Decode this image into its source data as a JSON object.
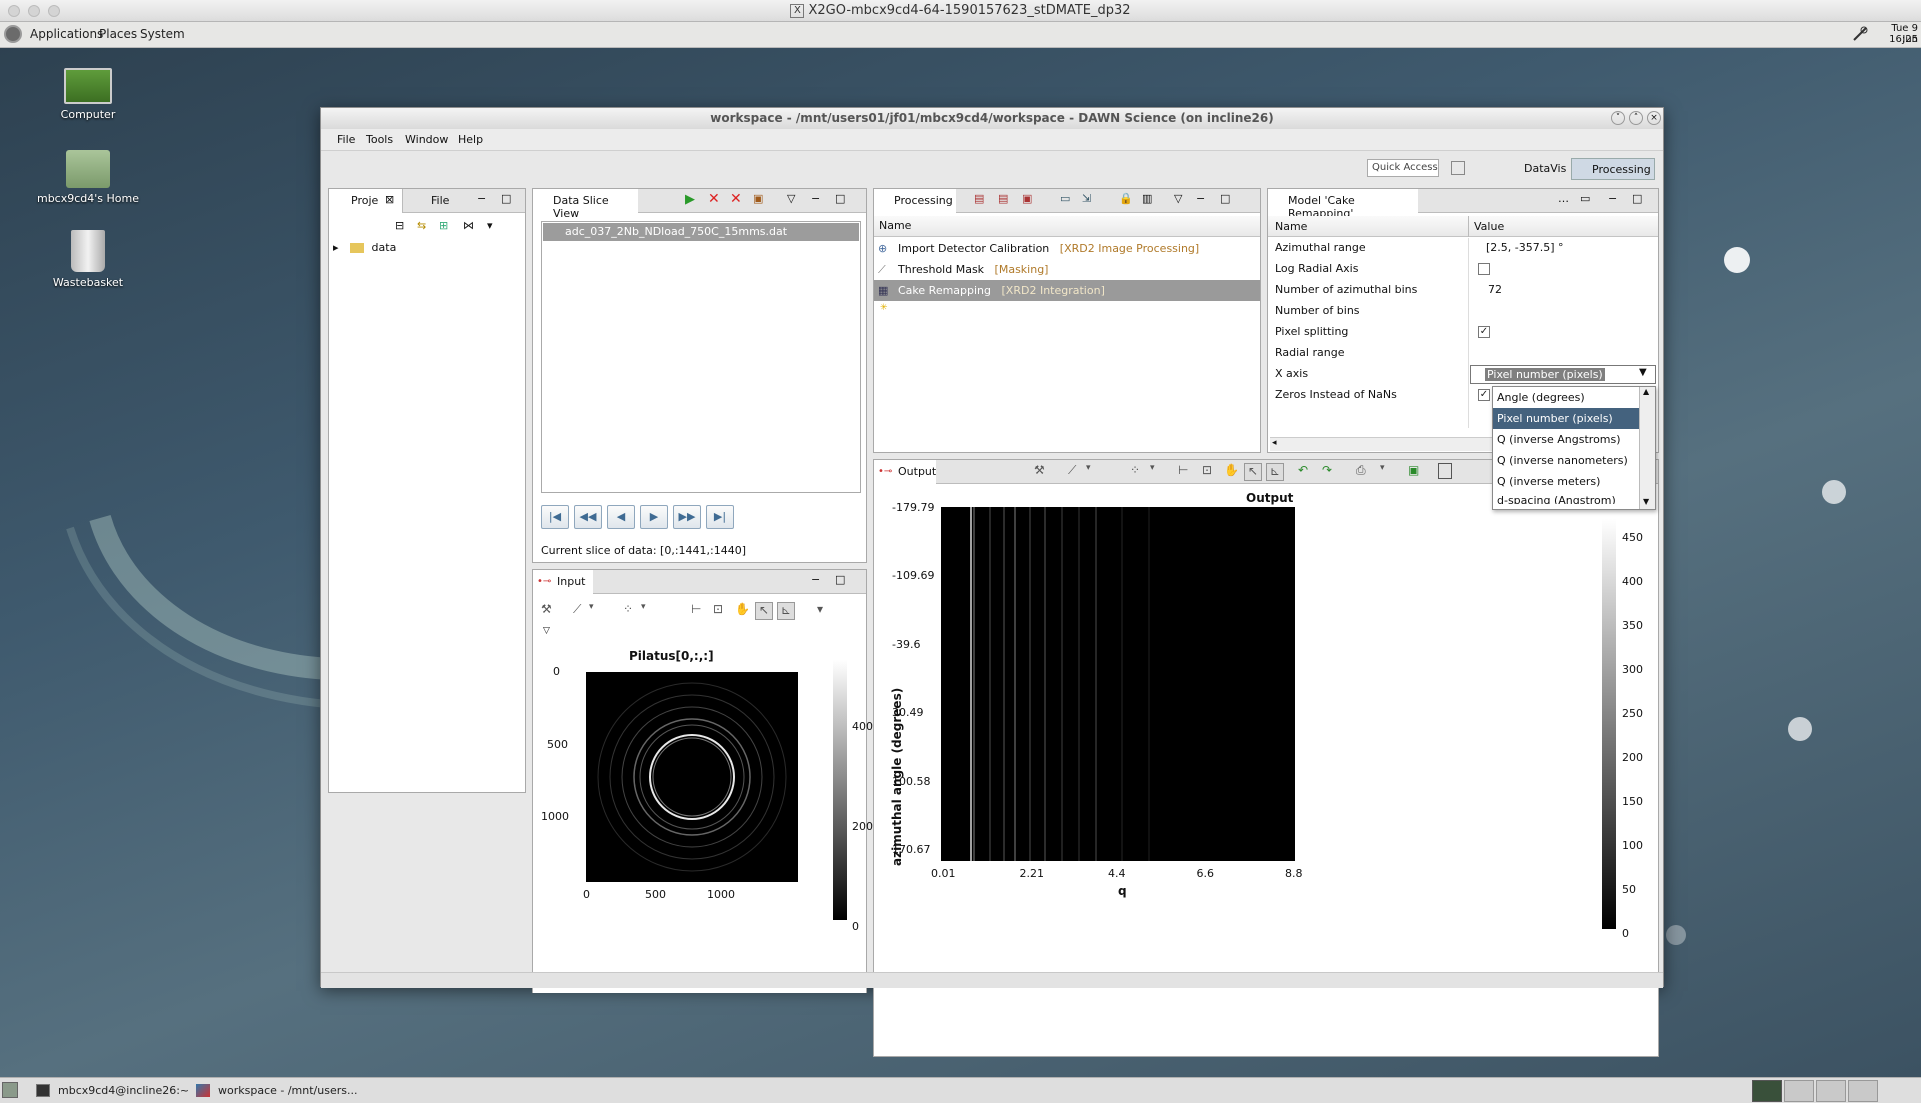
{
  "mac_title": "X2GO-mbcx9cd4-64-1590157623_stDMATE_dp32",
  "top_panel": {
    "applications": "Applications",
    "places": "Places",
    "system": "System",
    "clock_day": "Tue  9 Jun",
    "clock_time": "16:25"
  },
  "desktop_icons": [
    {
      "label": "Computer"
    },
    {
      "label": "mbcx9cd4's Home"
    },
    {
      "label": "Wastebasket"
    }
  ],
  "window": {
    "title": "workspace - /mnt/users01/jf01/mbcx9cd4/workspace - DAWN Science  (on incline26)",
    "menu": [
      "File",
      "Tools",
      "Window",
      "Help"
    ],
    "quick_access": "Quick Access",
    "perspectives": [
      "DataVis",
      "Processing"
    ]
  },
  "project_panel": {
    "tabs": [
      "Proje",
      "File"
    ],
    "tree": [
      {
        "label": "data"
      }
    ]
  },
  "slice_view": {
    "title": "Data Slice View",
    "file": "adc_037_2Nb_NDload_750C_15mms.dat",
    "current_slice": "Current slice of data: [0,:1441,:1440]"
  },
  "processing": {
    "title": "Processing",
    "column": "Name",
    "rows": [
      {
        "name": "Import Detector Calibration",
        "tag": "[XRD2 Image Processing]"
      },
      {
        "name": "Threshold Mask",
        "tag": "[Masking]"
      },
      {
        "name": "Cake Remapping",
        "tag": "[XRD2 Integration]"
      }
    ]
  },
  "model": {
    "title": "Model 'Cake Remapping'",
    "col_name": "Name",
    "col_value": "Value",
    "rows": [
      {
        "name": "Azimuthal range",
        "value": "[2.5, -357.5] °"
      },
      {
        "name": "Log Radial Axis",
        "value": ""
      },
      {
        "name": "Number of azimuthal bins",
        "value": "72"
      },
      {
        "name": "Number of bins",
        "value": ""
      },
      {
        "name": "Pixel splitting",
        "value": "✓"
      },
      {
        "name": "Radial range",
        "value": ""
      },
      {
        "name": "X axis",
        "value": "Pixel number (pixels)"
      },
      {
        "name": "Zeros Instead of NaNs",
        "value": "✓"
      }
    ],
    "dropdown_options": [
      "Angle (degrees)",
      "Pixel number (pixels)",
      "Q (inverse Angstroms)",
      "Q (inverse nanometers)",
      "Q (inverse meters)",
      "d-spacing (Angstrom)"
    ],
    "dropdown_selected": "Pixel number (pixels)"
  },
  "input_plot": {
    "tab": "Input",
    "title": "Pilatus[0,:,:]",
    "y_ticks": [
      "0",
      "500",
      "1000"
    ],
    "x_ticks": [
      "0",
      "500",
      "1000"
    ],
    "colorbar_ticks": [
      "400",
      "200",
      "0"
    ]
  },
  "output_plot": {
    "tab": "Output",
    "title": "Output",
    "ylabel": "azimuthal angle (degrees)",
    "xlabel": "q",
    "y_ticks": [
      "-179.79",
      "-109.69",
      "-39.6",
      "30.49",
      "100.58",
      "170.67"
    ],
    "x_ticks": [
      "0.01",
      "2.21",
      "4.4",
      "6.6",
      "8.8"
    ],
    "colorbar_ticks": [
      "450",
      "400",
      "350",
      "300",
      "250",
      "200",
      "150",
      "100",
      "50",
      "0"
    ]
  },
  "taskbar": [
    {
      "label": "mbcx9cd4@incline26:~"
    },
    {
      "label": "workspace - /mnt/users..."
    }
  ]
}
